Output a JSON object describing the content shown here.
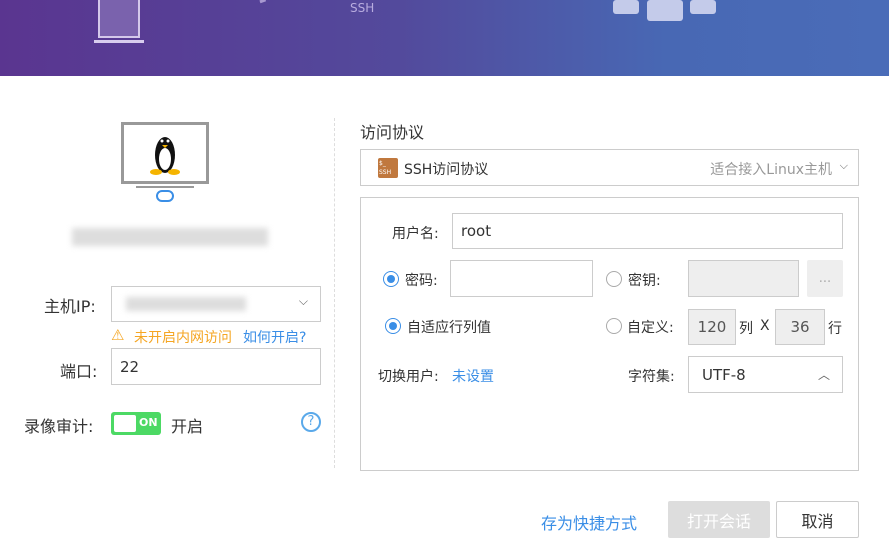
{
  "banner": {
    "ssh_label": "SSH"
  },
  "host": {
    "ip_label": "主机IP:",
    "warning_text": "未开启内网访问",
    "how_link": "如何开启?",
    "port_label": "端口:",
    "port_value": "22",
    "record_label": "录像审计:",
    "toggle_text": "ON",
    "toggle_state": "开启"
  },
  "protocol": {
    "section_title": "访问协议",
    "selected": "SSH访问协议",
    "hint": "适合接入Linux主机",
    "icon_text_top": "$_",
    "icon_text_bottom": "SSH"
  },
  "form": {
    "username_label": "用户名:",
    "username_value": "root",
    "password_label": "密码:",
    "key_label": "密钥:",
    "browse_label": "...",
    "adaptive_label": "自适应行列值",
    "custom_label": "自定义:",
    "cols_value": "120",
    "cols_label": "列",
    "x_label": "X",
    "rows_value": "36",
    "rows_label": "行",
    "switch_user_label": "切换用户:",
    "switch_user_value": "未设置",
    "charset_label": "字符集:",
    "charset_value": "UTF-8"
  },
  "footer": {
    "shortcut": "存为快捷方式",
    "open": "打开会话",
    "cancel": "取消"
  },
  "colors": {
    "accent": "#3a8ee6",
    "warning": "#f5a623",
    "toggle": "#4cd964"
  }
}
